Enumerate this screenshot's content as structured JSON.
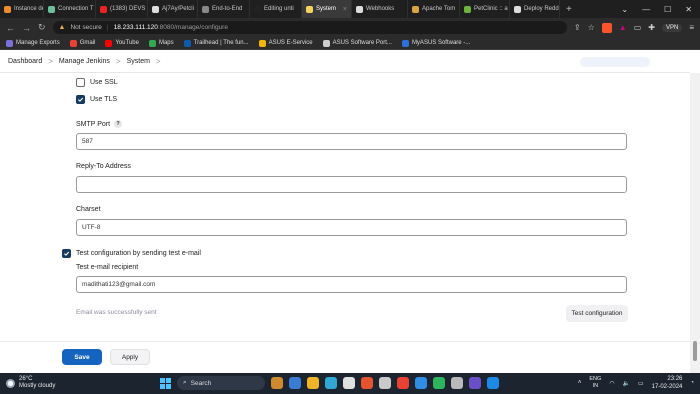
{
  "browser": {
    "tabs": [
      {
        "label": "Instance det",
        "color": "#f08c2c",
        "active": false
      },
      {
        "label": "Connection T",
        "color": "#6cbf9a",
        "active": false
      },
      {
        "label": "(1383) DEVS",
        "color": "#e22",
        "active": false
      },
      {
        "label": "Aj7Ay/Petcli",
        "color": "#ddd",
        "active": false
      },
      {
        "label": "End-to-End",
        "color": "#888",
        "active": false
      },
      {
        "label": "Editing unti",
        "color": "#222",
        "active": false
      },
      {
        "label": "System",
        "color": "#f2d35b",
        "active": true
      },
      {
        "label": "Webhooks",
        "color": "#ddd",
        "active": false
      },
      {
        "label": "Apache Tom",
        "color": "#d9a441",
        "active": false
      },
      {
        "label": "PetClinic :: a",
        "color": "#6db33f",
        "active": false
      },
      {
        "label": "Deploy Redd",
        "color": "#ddd",
        "active": false
      }
    ],
    "new_tab": "+",
    "window_controls": [
      "⌄",
      "—",
      "☐",
      "✕"
    ],
    "address": {
      "security": "Not secure",
      "host": "18.233.111.120",
      "path": ":8080/manage/configure"
    },
    "vpn_label": "VPN",
    "bookmarks": [
      {
        "label": "Manage Exports",
        "color": "#7b6fd8"
      },
      {
        "label": "Gmail",
        "color": "#e94235"
      },
      {
        "label": "YouTube",
        "color": "#ff0000"
      },
      {
        "label": "Maps",
        "color": "#34a853"
      },
      {
        "label": "Trailhead | The fun...",
        "color": "#0b5cab"
      },
      {
        "label": "ASUS E-Service",
        "color": "#f2b705"
      },
      {
        "label": "ASUS Software Port...",
        "color": "#cccccc"
      },
      {
        "label": "MyASUS Software -...",
        "color": "#2e6fd9"
      }
    ]
  },
  "breadcrumb": {
    "items": [
      "Dashboard",
      "Manage Jenkins",
      "System"
    ],
    "separator": ">"
  },
  "form": {
    "use_ssl": {
      "label": "Use SSL",
      "checked": false
    },
    "use_tls": {
      "label": "Use TLS",
      "checked": true
    },
    "smtp_port": {
      "label": "SMTP Port",
      "help": "?",
      "value": "587"
    },
    "reply_to": {
      "label": "Reply-To Address",
      "value": ""
    },
    "charset": {
      "label": "Charset",
      "value": "UTF-8"
    },
    "test_config": {
      "label": "Test configuration by sending test e-mail",
      "checked": true
    },
    "recipient": {
      "label": "Test e-mail recipient",
      "value": "madithati123@gmail.com"
    },
    "success_message": "Email was successfully sent",
    "test_button": "Test configuration"
  },
  "footer": {
    "save_label": "Save",
    "apply_label": "Apply"
  },
  "taskbar": {
    "weather_temp": "26°C",
    "weather_desc": "Mostly cloudy",
    "search_placeholder": "Search",
    "lang_line1": "ENG",
    "lang_line2": "IN",
    "time": "23:26",
    "date": "17-02-2024",
    "app_icon_colors": [
      "#d08a2e",
      "#3b7bd4",
      "#f0b429",
      "#2fa8d6",
      "#e0e0e0",
      "#e5532f",
      "#c9c9c9",
      "#e94235",
      "#2f8de4",
      "#2db55d",
      "#b9b9b9",
      "#6b4fc9",
      "#1e88e5"
    ]
  }
}
